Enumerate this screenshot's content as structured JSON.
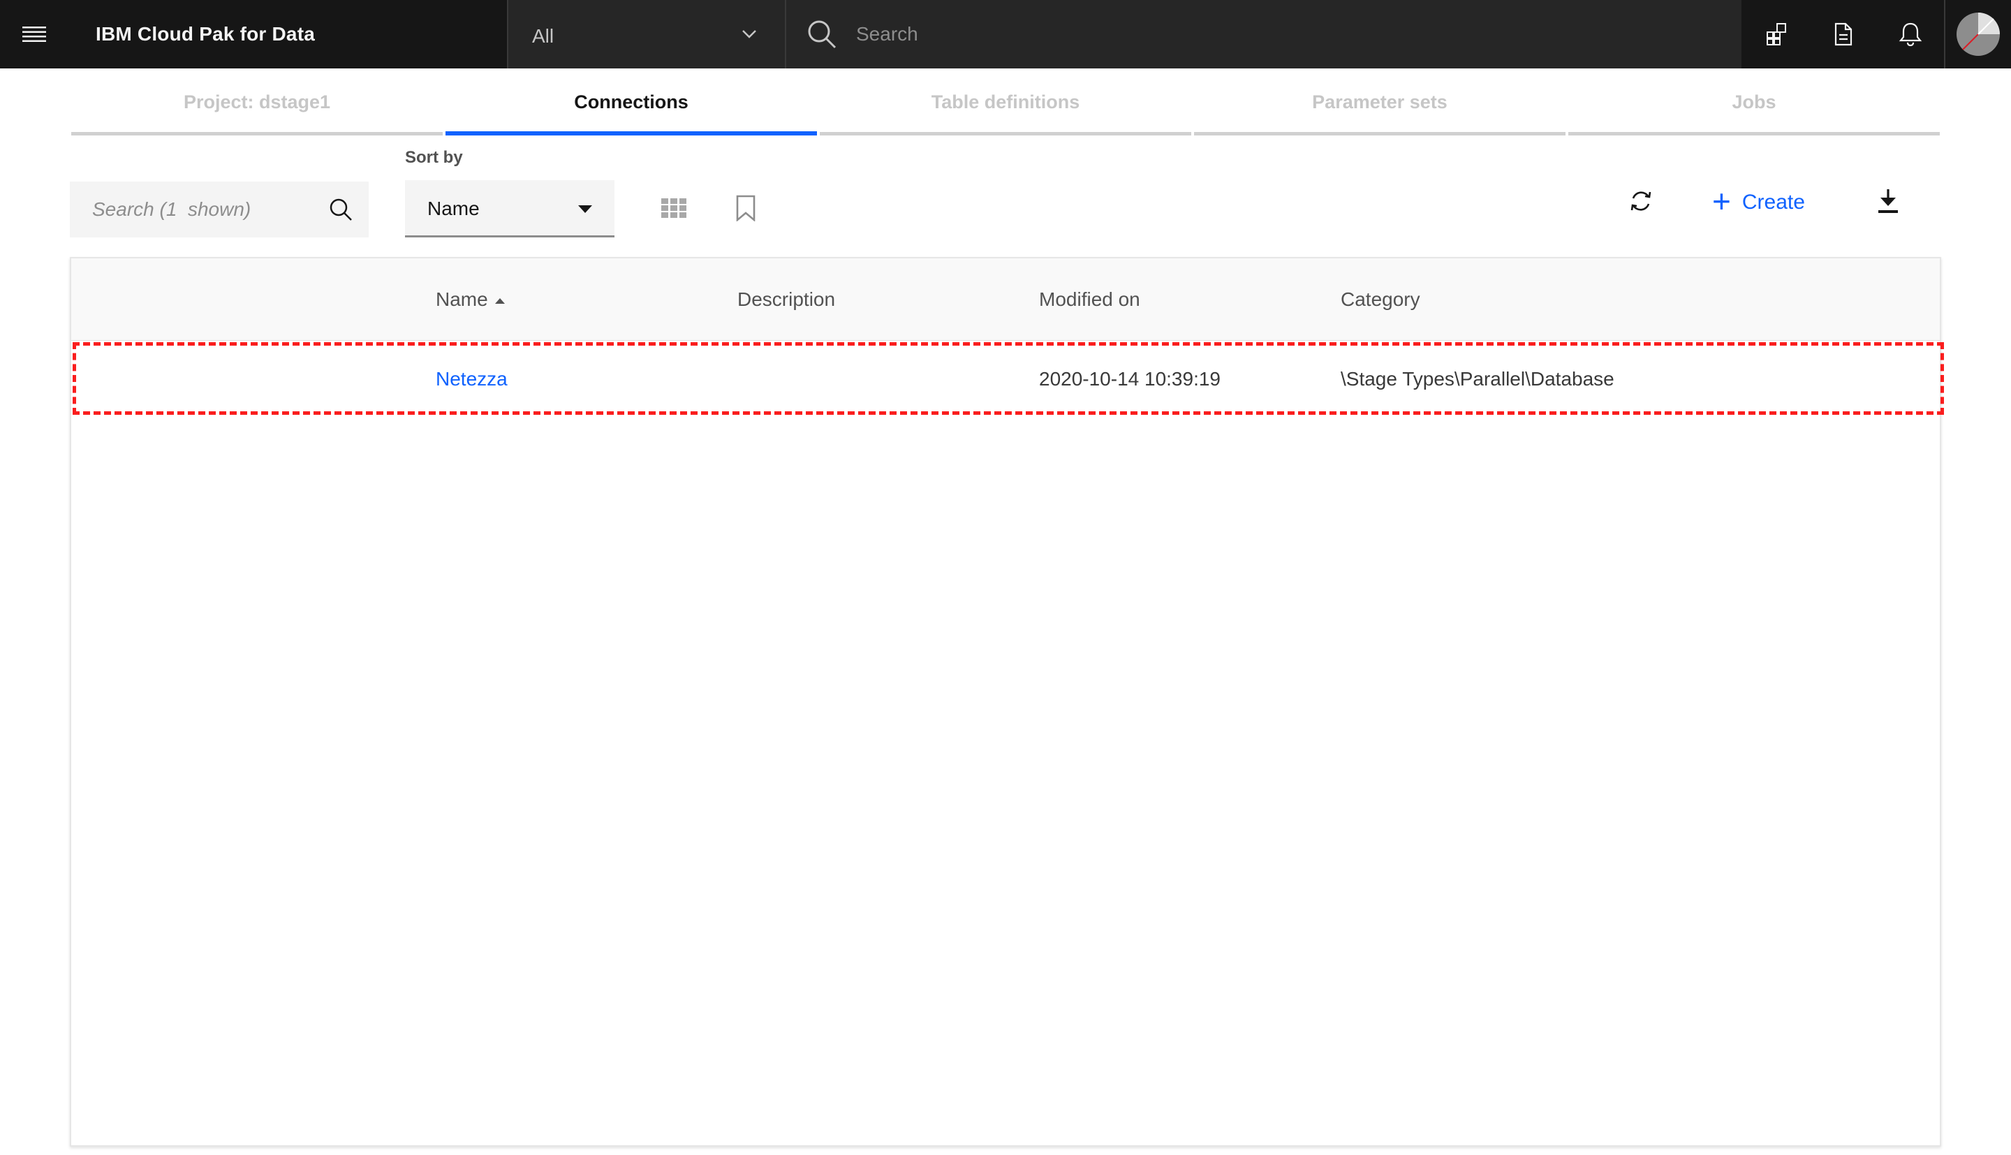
{
  "header": {
    "app_title": "IBM Cloud Pak for Data",
    "scope_value": "All",
    "search_placeholder": "Search",
    "menu_icon": "hamburger-menu-icon",
    "actions": [
      "apps-icon",
      "document-icon",
      "notification-bell-icon"
    ],
    "avatar_icon": "user-avatar-icon"
  },
  "tabs": [
    {
      "label": "Project: dstage1",
      "active": false
    },
    {
      "label": "Connections",
      "active": true
    },
    {
      "label": "Table definitions",
      "active": false
    },
    {
      "label": "Parameter sets",
      "active": false
    },
    {
      "label": "Jobs",
      "active": false
    }
  ],
  "toolbar": {
    "search_placeholder": "Search (1  shown)",
    "sort_by_label": "Sort by",
    "sort_value": "Name",
    "create_label": "Create",
    "icons": [
      "grid-view-icon",
      "bookmark-icon",
      "refresh-icon",
      "plus-icon",
      "download-icon"
    ]
  },
  "table": {
    "columns": [
      "Name",
      "Description",
      "Modified on",
      "Category"
    ],
    "sorted_column": "Name",
    "sort_direction": "ascending",
    "rows": [
      {
        "name": "Netezza",
        "description": "",
        "modified_on": "2020-10-14 10:39:19",
        "category": "\\Stage Types\\Parallel\\Database"
      }
    ]
  },
  "colors": {
    "header_bg": "#161616",
    "accent": "#0f62fe",
    "highlight": "#fa1e1e"
  }
}
